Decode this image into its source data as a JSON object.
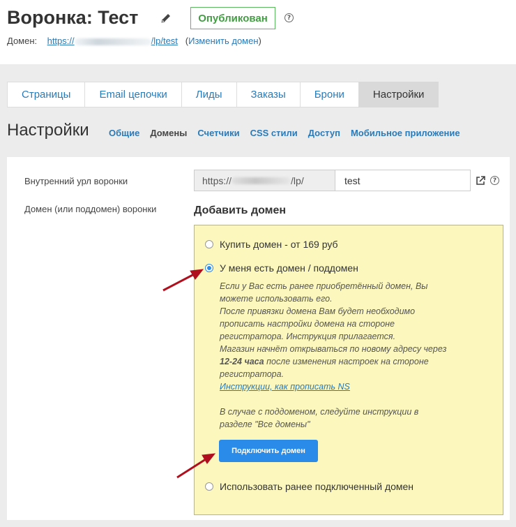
{
  "header": {
    "title": "Воронка: Тест",
    "status": "Опубликован",
    "help_icon": "?",
    "domain_label": "Домен:",
    "domain_prefix": "https://",
    "domain_suffix": "/lp/test",
    "change_domain_open": "(",
    "change_domain": "Изменить домен",
    "change_domain_close": ")"
  },
  "tabs": [
    {
      "label": "Страницы"
    },
    {
      "label": "Email цепочки"
    },
    {
      "label": "Лиды"
    },
    {
      "label": "Заказы"
    },
    {
      "label": "Брони"
    },
    {
      "label": "Настройки",
      "active": true
    }
  ],
  "page": {
    "heading": "Настройки",
    "subnav": [
      {
        "label": "Общие"
      },
      {
        "label": "Домены",
        "active": true
      },
      {
        "label": "Счетчики"
      },
      {
        "label": "CSS стили"
      },
      {
        "label": "Доступ"
      },
      {
        "label": "Мобильное приложение"
      }
    ]
  },
  "settings": {
    "internal_url_label": "Внутренний урл воронки",
    "url_prefix_start": "https://",
    "url_prefix_end": "/lp/",
    "url_value": "test",
    "domain_label": "Домен (или поддомен) воронки",
    "add_domain_title": "Добавить домен",
    "options": {
      "buy": "Купить домен - от 169 руб",
      "have": "У меня есть домен / поддомен",
      "use_existing": "Использовать ранее подключенный домен"
    },
    "selected_option": "have",
    "info": {
      "line1": "Если у Вас есть ранее приобретённый домен, Вы можете использовать его.",
      "line2": "После привязки домена Вам будет необходимо прописать настройки домена на стороне регистратора. Инструкция прилагается.",
      "line3_pre": "Магазин начнёт открываться по новому адресу через ",
      "line3_bold": "12-24 часа",
      "line3_post": " после изменения настроек на стороне регистратора.",
      "ns_link": "Инструкции, как прописать NS",
      "subdomain": "В случае с поддоменом, следуйте инструкции в разделе \"Все домены\""
    },
    "connect_button": "Подключить домен"
  },
  "colors": {
    "accent": "#2a8be8",
    "link": "#2a7ab8",
    "published": "#449d44",
    "notice_bg": "#fbf7bd",
    "arrow": "#b0101e"
  },
  "icons": [
    "pencil-icon",
    "help-icon",
    "external-link-icon",
    "arrow-icon"
  ]
}
